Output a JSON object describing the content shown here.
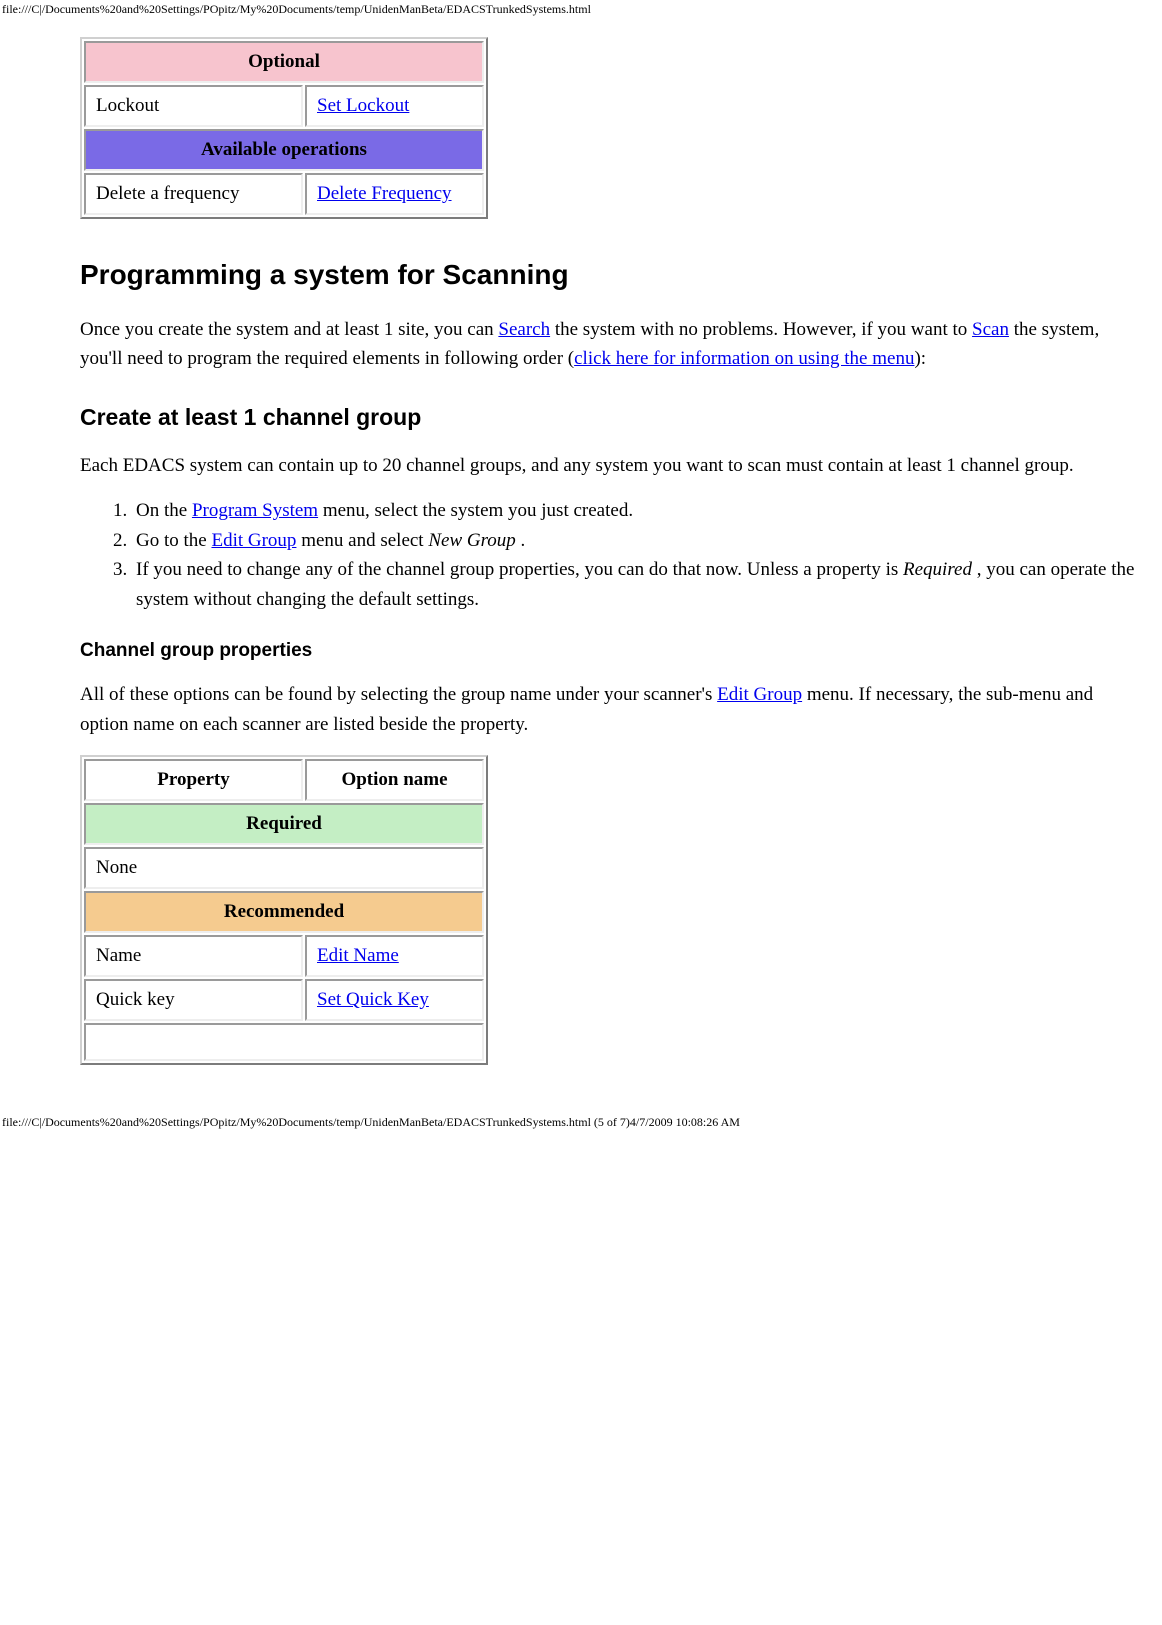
{
  "url_top": "file:///C|/Documents%20and%20Settings/POpitz/My%20Documents/temp/UnidenManBeta/EDACSTrunkedSystems.html",
  "url_bottom": "file:///C|/Documents%20and%20Settings/POpitz/My%20Documents/temp/UnidenManBeta/EDACSTrunkedSystems.html (5 of 7)4/7/2009 10:08:26 AM",
  "table1": {
    "optional_hdr": "Optional",
    "lockout_label": "Lockout",
    "lockout_link": "Set Lockout",
    "avail_hdr": "Available operations",
    "delete_label": "Delete a frequency",
    "delete_link": "Delete Frequency"
  },
  "h2": "Programming a system for Scanning",
  "para1": {
    "t1": "Once you create the system and at least 1 site, you can ",
    "l1": "Search",
    "t2": " the system with no problems. However, if you want to ",
    "l2": "Scan",
    "t3": " the system, you'll need to program the required elements in following order (",
    "l3": "click here for information on using the menu",
    "t4": "):"
  },
  "h3": "Create at least 1 channel group",
  "para2": "Each EDACS system can contain up to 20 channel groups, and any system you want to scan must contain at least 1 channel group.",
  "list": {
    "i1": {
      "t1": "On the ",
      "l1": "Program System",
      "t2": " menu, select the system you just created."
    },
    "i2": {
      "t1": "Go to the ",
      "l1": "Edit Group",
      "t2": " menu and select ",
      "em": "New Group",
      "t3": " ."
    },
    "i3": {
      "t1": "If you need to change any of the channel group properties, you can do that now. Unless a property is ",
      "em": "Required",
      "t2": " , you can operate the system without changing the default settings."
    }
  },
  "h4": "Channel group properties",
  "para3": {
    "t1": "All of these options can be found by selecting the group name under your scanner's ",
    "l1": "Edit Group",
    "t2": " menu. If necessary, the sub-menu and option name on each scanner are listed beside the property."
  },
  "table2": {
    "prop_hdr": "Property",
    "opt_hdr": "Option name",
    "required_hdr": "Required",
    "none": "None",
    "recommended_hdr": "Recommended",
    "name_label": "Name",
    "name_link": "Edit Name",
    "qk_label": "Quick key",
    "qk_link": "Set Quick Key"
  }
}
